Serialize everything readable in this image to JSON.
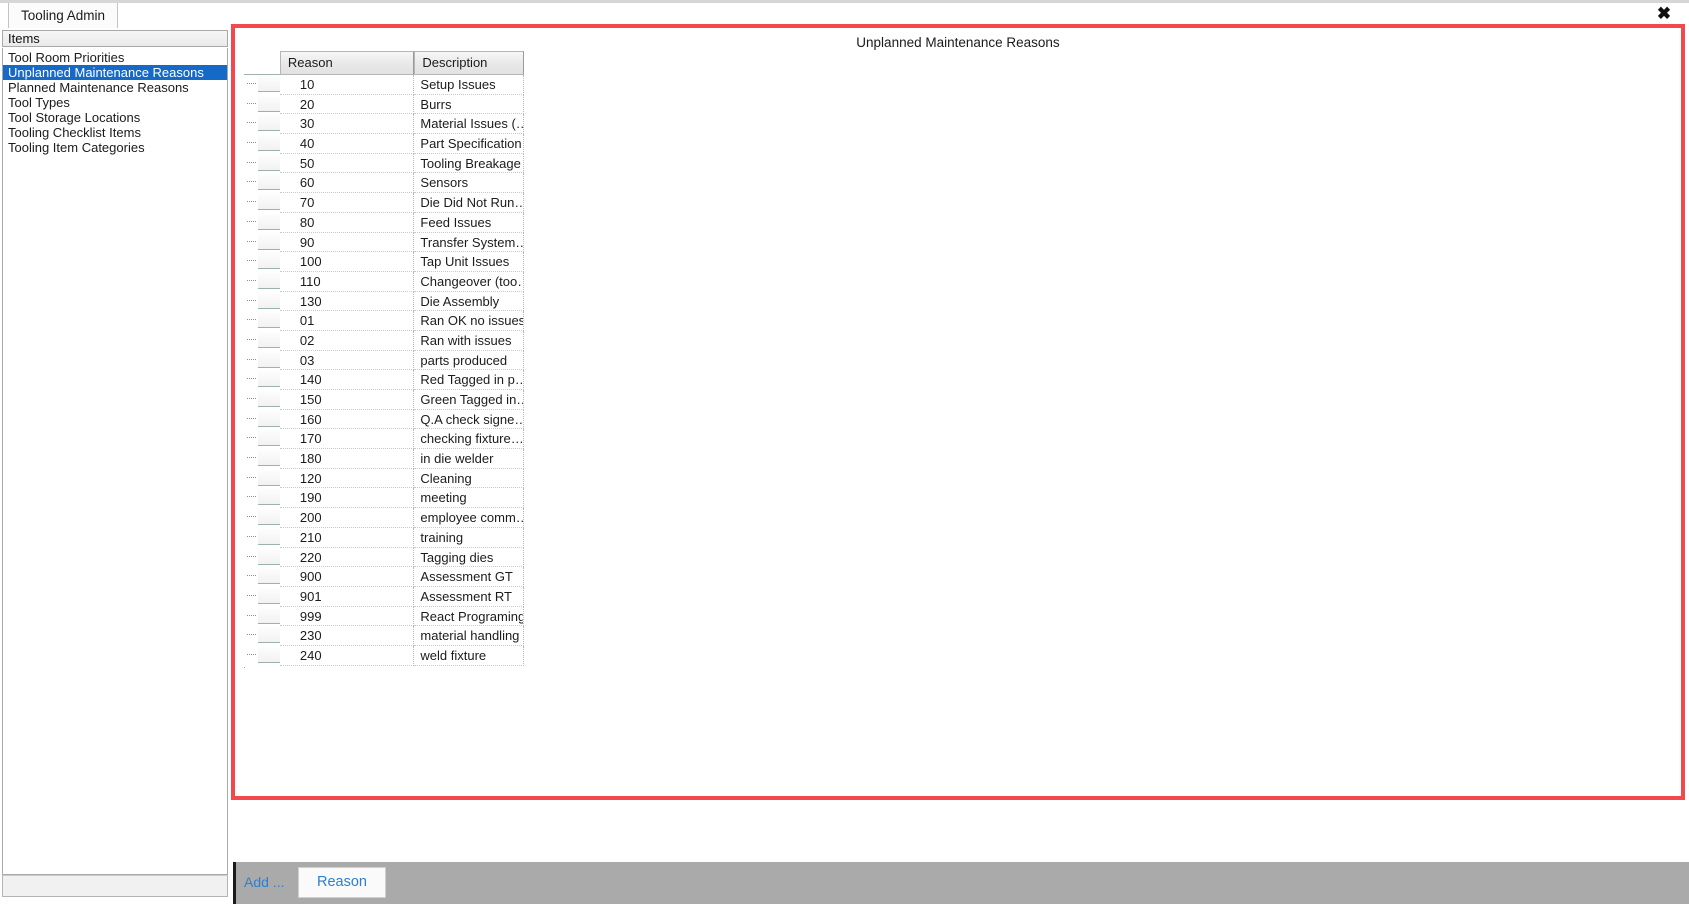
{
  "window": {
    "close_icon": "close-icon",
    "close_glyph": "✖"
  },
  "tabs": [
    {
      "label": "Tooling Admin",
      "active": true
    }
  ],
  "sidebar": {
    "header": "Items",
    "items": [
      {
        "label": "Tool Room Priorities",
        "selected": false
      },
      {
        "label": "Unplanned Maintenance Reasons",
        "selected": true
      },
      {
        "label": "Planned Maintenance Reasons",
        "selected": false
      },
      {
        "label": "Tool Types",
        "selected": false
      },
      {
        "label": "Tool Storage Locations",
        "selected": false
      },
      {
        "label": "Tooling Checklist Items",
        "selected": false
      },
      {
        "label": "Tooling Item Categories",
        "selected": false
      }
    ]
  },
  "content": {
    "title": "Unplanned Maintenance Reasons",
    "highlight_color": "#f4494c",
    "grid": {
      "columns": [
        "Reason",
        "Description"
      ],
      "rows": [
        {
          "reason": "10",
          "description": "Setup Issues"
        },
        {
          "reason": "20",
          "description": "Burrs"
        },
        {
          "reason": "30",
          "description": "Material Issues (…"
        },
        {
          "reason": "40",
          "description": "Part Specification"
        },
        {
          "reason": "50",
          "description": "Tooling Breakage"
        },
        {
          "reason": "60",
          "description": "Sensors"
        },
        {
          "reason": "70",
          "description": "Die Did Not Run…"
        },
        {
          "reason": "80",
          "description": "Feed Issues"
        },
        {
          "reason": "90",
          "description": "Transfer System…"
        },
        {
          "reason": "100",
          "description": "Tap Unit Issues"
        },
        {
          "reason": "110",
          "description": "Changeover  (too…"
        },
        {
          "reason": "130",
          "description": "Die Assembly"
        },
        {
          "reason": "01",
          "description": "Ran OK no issues"
        },
        {
          "reason": "02",
          "description": "Ran with issues"
        },
        {
          "reason": "03",
          "description": "parts produced"
        },
        {
          "reason": "140",
          "description": "Red Tagged in p…"
        },
        {
          "reason": "150",
          "description": "Green Tagged in…"
        },
        {
          "reason": "160",
          "description": "Q.A check signe…"
        },
        {
          "reason": "170",
          "description": "checking fixture…"
        },
        {
          "reason": "180",
          "description": "in die welder"
        },
        {
          "reason": "120",
          "description": "Cleaning"
        },
        {
          "reason": "190",
          "description": "meeting"
        },
        {
          "reason": "200",
          "description": "employee  comm…"
        },
        {
          "reason": "210",
          "description": "training"
        },
        {
          "reason": "220",
          "description": "Tagging dies"
        },
        {
          "reason": "900",
          "description": "Assessment GT"
        },
        {
          "reason": "901",
          "description": "Assessment RT"
        },
        {
          "reason": "999",
          "description": "React Programing"
        },
        {
          "reason": "230",
          "description": "material handling"
        },
        {
          "reason": "240",
          "description": "weld fixture"
        }
      ]
    }
  },
  "bottom_bar": {
    "add_label": "Add ...",
    "reason_button": "Reason"
  }
}
